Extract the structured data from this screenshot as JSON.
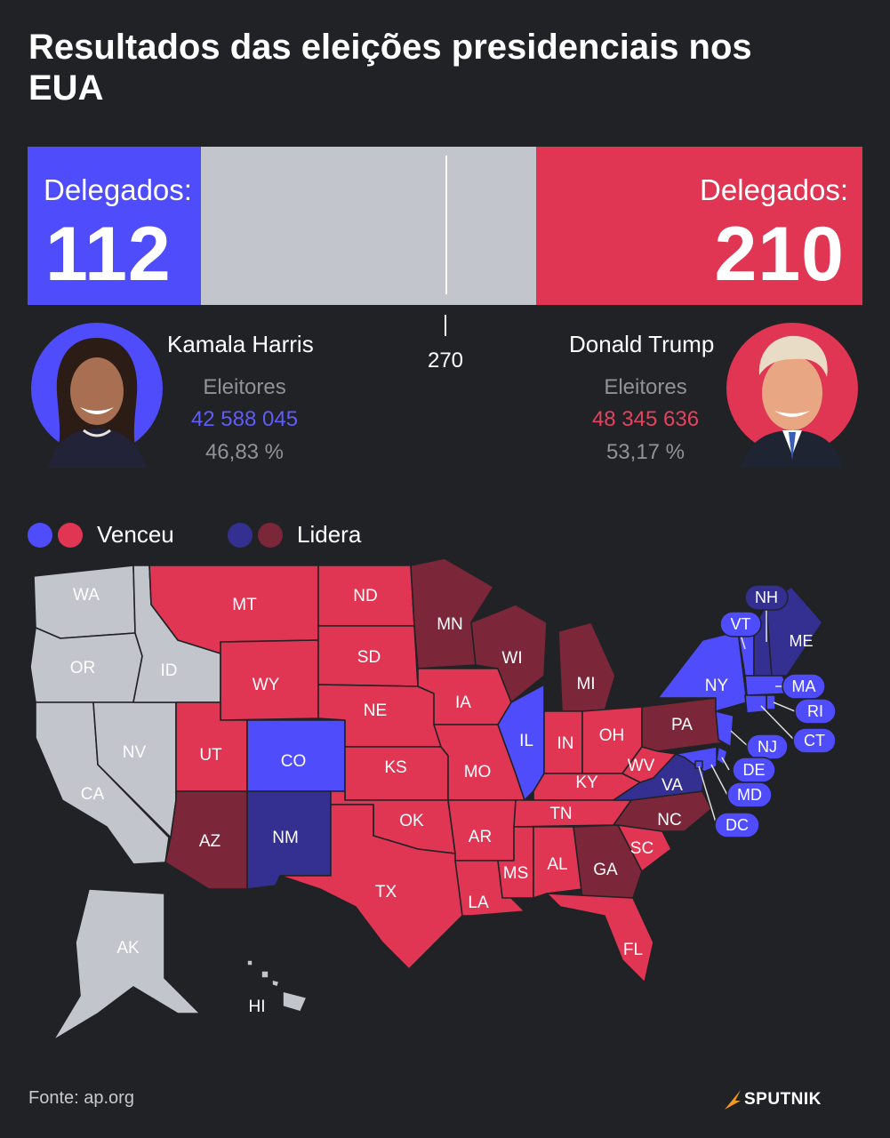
{
  "title": "Resultados das eleições presidenciais nos EUA",
  "colors": {
    "dem_won": "#4f4cfb",
    "rep_won": "#e03553",
    "dem_lead": "#343092",
    "rep_lead": "#7b2739",
    "undecided": "#c3c5cc",
    "background": "#202225"
  },
  "delegates": {
    "label": "Delegados:",
    "harris": "112",
    "trump": "210",
    "threshold": "270",
    "total": 538
  },
  "harris": {
    "name": "Kamala Harris",
    "voters_label": "Eleitores",
    "votes": "42 588 045",
    "percent": "46,83 %"
  },
  "trump": {
    "name": "Donald Trump",
    "voters_label": "Eleitores",
    "votes": "48 345 636",
    "percent": "53,17 %"
  },
  "legend": {
    "won": "Venceu",
    "leading": "Lidera"
  },
  "states": {
    "WA": "WA",
    "OR": "OR",
    "CA": "CA",
    "NV": "NV",
    "ID": "ID",
    "MT": "MT",
    "WY": "WY",
    "UT": "UT",
    "CO": "CO",
    "AZ": "AZ",
    "NM": "NM",
    "ND": "ND",
    "SD": "SD",
    "NE": "NE",
    "KS": "KS",
    "OK": "OK",
    "TX": "TX",
    "MN": "MN",
    "IA": "IA",
    "MO": "MO",
    "AR": "AR",
    "LA": "LA",
    "WI": "WI",
    "IL": "IL",
    "MI": "MI",
    "IN": "IN",
    "OH": "OH",
    "KY": "KY",
    "TN": "TN",
    "MS": "MS",
    "AL": "AL",
    "GA": "GA",
    "FL": "FL",
    "SC": "SC",
    "NC": "NC",
    "VA": "VA",
    "WV": "WV",
    "PA": "PA",
    "NY": "NY",
    "VT": "VT",
    "NH": "NH",
    "ME": "ME",
    "MA": "MA",
    "RI": "RI",
    "CT": "CT",
    "NJ": "NJ",
    "DE": "DE",
    "MD": "MD",
    "DC": "DC",
    "AK": "AK",
    "HI": "HI"
  },
  "source": "Fonte: ap.org",
  "brand": "SPUTNIK"
}
